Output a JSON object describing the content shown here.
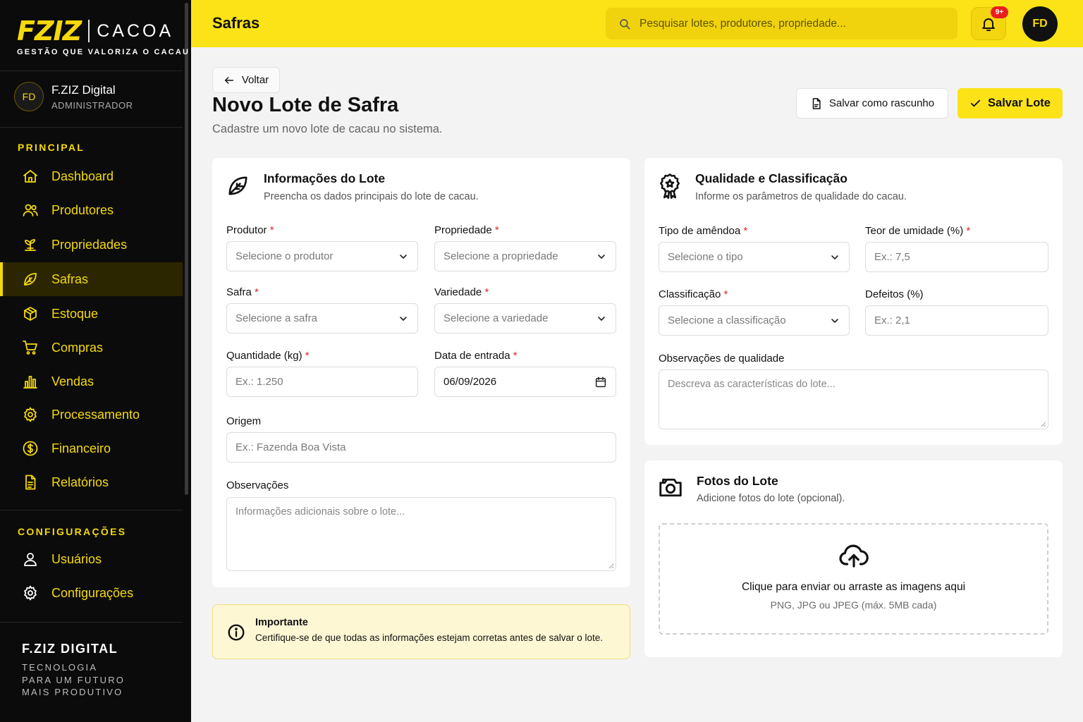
{
  "brand": {
    "logo": "FZIZ",
    "name": "CACOA",
    "tagline": "GESTÃO QUE VALORIZA O CACAU"
  },
  "user": {
    "initials": "FD",
    "name": "F.ZIZ Digital",
    "role": "ADMINISTRADOR"
  },
  "sidebar": {
    "principal_label": "PRINCIPAL",
    "items": [
      {
        "label": "Dashboard",
        "icon": "home-icon"
      },
      {
        "label": "Produtores",
        "icon": "users-icon"
      },
      {
        "label": "Propriedades",
        "icon": "sprout-icon"
      },
      {
        "label": "Safras",
        "icon": "leaf-icon",
        "active": true
      },
      {
        "label": "Estoque",
        "icon": "box-icon"
      },
      {
        "label": "Compras",
        "icon": "cart-icon"
      },
      {
        "label": "Vendas",
        "icon": "bar-chart-icon"
      },
      {
        "label": "Processamento",
        "icon": "gear-icon"
      },
      {
        "label": "Financeiro",
        "icon": "dollar-icon"
      },
      {
        "label": "Relatórios",
        "icon": "document-icon"
      }
    ],
    "config_label": "CONFIGURAÇÕES",
    "config_items": [
      {
        "label": "Usuários",
        "icon": "user-icon"
      },
      {
        "label": "Configurações",
        "icon": "gear-icon"
      }
    ],
    "footer_title": "F.ZIZ DIGITAL",
    "footer_lines": [
      "TECNOLOGIA",
      "PARA UM FUTURO",
      "MAIS PRODUTIVO"
    ]
  },
  "topbar": {
    "title": "Safras",
    "search_placeholder": "Pesquisar lotes, produtores, propriedade...",
    "notification_badge": "9+",
    "avatar_initials": "FD"
  },
  "header": {
    "back_label": "Voltar",
    "title": "Novo Lote de Safra",
    "subtitle": "Cadastre um novo lote de cacau no sistema.",
    "draft_label": "Salvar como rascunho",
    "save_label": "Salvar Lote"
  },
  "lote_card": {
    "title": "Informações do Lote",
    "subtitle": "Preencha os dados principais do lote de cacau.",
    "produtor_label": "Produtor",
    "produtor_placeholder": "Selecione o produtor",
    "propriedade_label": "Propriedade",
    "propriedade_placeholder": "Selecione a propriedade",
    "safra_label": "Safra",
    "safra_placeholder": "Selecione a safra",
    "variedade_label": "Variedade",
    "variedade_placeholder": "Selecione a variedade",
    "quantidade_label": "Quantidade (kg)",
    "quantidade_placeholder": "Ex.: 1.250",
    "data_label": "Data de entrada",
    "data_value": "06/09/2026",
    "origem_label": "Origem",
    "origem_placeholder": "Ex.: Fazenda Boa Vista",
    "obs_label": "Observações",
    "obs_placeholder": "Informações adicionais sobre o lote..."
  },
  "qualidade_card": {
    "title": "Qualidade e Classificação",
    "subtitle": "Informe os parâmetros de qualidade do cacau.",
    "tipo_label": "Tipo de amêndoa",
    "tipo_placeholder": "Selecione o tipo",
    "umidade_label": "Teor de umidade (%)",
    "umidade_placeholder": "Ex.: 7,5",
    "classificacao_label": "Classificação",
    "classificacao_placeholder": "Selecione a classificação",
    "defeitos_label": "Defeitos (%)",
    "defeitos_placeholder": "Ex.: 2,1",
    "obs_label": "Observações de qualidade",
    "obs_placeholder": "Descreva as características do lote..."
  },
  "fotos_card": {
    "title": "Fotos do Lote",
    "subtitle": "Adicione fotos do lote (opcional).",
    "upload_text": "Clique para enviar ou arraste as imagens aqui",
    "upload_hint": "PNG, JPG ou JPEG (máx. 5MB cada)"
  },
  "note": {
    "title": "Importante",
    "text": "Certifique-se de que todas as informações estejam corretas antes de salvar o lote."
  },
  "required_marker": "*",
  "colors": {
    "accent": "#fbe318",
    "sidebar_bg": "#0b0b0b",
    "required": "#e02424"
  }
}
